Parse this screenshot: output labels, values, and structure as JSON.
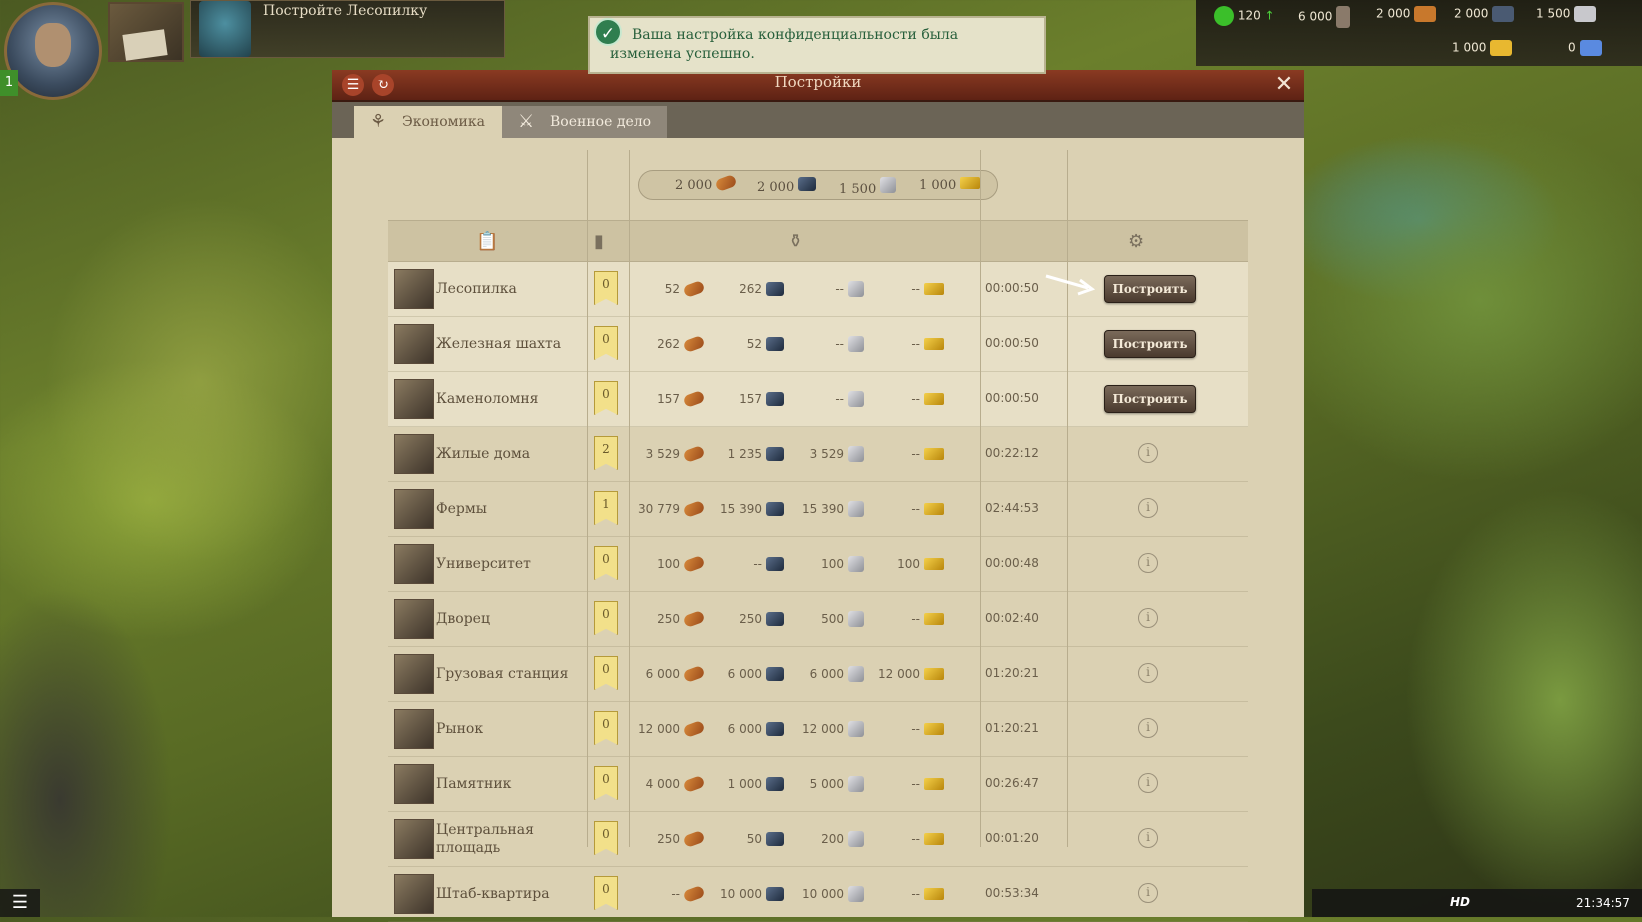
{
  "quest": {
    "text": "Постройте Лесопилку"
  },
  "player": {
    "level": "1"
  },
  "notification": {
    "text": "Ваша настройка конфиденциальности была изменена успешно."
  },
  "hud": {
    "row1": [
      {
        "value": "120",
        "icon": "happy-face-icon"
      },
      {
        "value": "6 000",
        "icon": "population-icon"
      },
      {
        "value": "2 000",
        "icon": "wood-icon"
      },
      {
        "value": "2 000",
        "icon": "iron-icon"
      },
      {
        "value": "1 500",
        "icon": "stone-icon"
      }
    ],
    "row2": [
      {
        "value": "1 000",
        "icon": "gold-icon"
      },
      {
        "value": "0",
        "icon": "gem-icon"
      }
    ],
    "time": "21:34:57",
    "hd": "HD"
  },
  "dialog": {
    "title": "Постройки",
    "tabs": [
      {
        "label": "Экономика",
        "active": true
      },
      {
        "label": "Военное дело",
        "active": false
      }
    ],
    "stock": {
      "wood": "2 000",
      "iron": "2 000",
      "stone": "1 500",
      "gold": "1 000"
    },
    "build_label": "Построить",
    "rows": [
      {
        "name": "Лесопилка",
        "level": "0",
        "wood": "52",
        "iron": "262",
        "stone": "--",
        "gold": "--",
        "time": "00:00:50",
        "action": "build"
      },
      {
        "name": "Железная шахта",
        "level": "0",
        "wood": "262",
        "iron": "52",
        "stone": "--",
        "gold": "--",
        "time": "00:00:50",
        "action": "build"
      },
      {
        "name": "Каменоломня",
        "level": "0",
        "wood": "157",
        "iron": "157",
        "stone": "--",
        "gold": "--",
        "time": "00:00:50",
        "action": "build"
      },
      {
        "name": "Жилые дома",
        "level": "2",
        "wood": "3 529",
        "iron": "1 235",
        "stone": "3 529",
        "gold": "--",
        "time": "00:22:12",
        "action": "info"
      },
      {
        "name": "Фермы",
        "level": "1",
        "wood": "30 779",
        "iron": "15 390",
        "stone": "15 390",
        "gold": "--",
        "time": "02:44:53",
        "action": "info"
      },
      {
        "name": "Университет",
        "level": "0",
        "wood": "100",
        "iron": "--",
        "stone": "100",
        "gold": "100",
        "time": "00:00:48",
        "action": "info"
      },
      {
        "name": "Дворец",
        "level": "0",
        "wood": "250",
        "iron": "250",
        "stone": "500",
        "gold": "--",
        "time": "00:02:40",
        "action": "info"
      },
      {
        "name": "Грузовая станция",
        "level": "0",
        "wood": "6 000",
        "iron": "6 000",
        "stone": "6 000",
        "gold": "12 000",
        "time": "01:20:21",
        "action": "info"
      },
      {
        "name": "Рынок",
        "level": "0",
        "wood": "12 000",
        "iron": "6 000",
        "stone": "12 000",
        "gold": "--",
        "time": "01:20:21",
        "action": "info"
      },
      {
        "name": "Памятник",
        "level": "0",
        "wood": "4 000",
        "iron": "1 000",
        "stone": "5 000",
        "gold": "--",
        "time": "00:26:47",
        "action": "info"
      },
      {
        "name": "Центральная площадь",
        "level": "0",
        "wood": "250",
        "iron": "50",
        "stone": "200",
        "gold": "--",
        "time": "00:01:20",
        "action": "info"
      },
      {
        "name": "Штаб-квартира",
        "level": "0",
        "wood": "--",
        "iron": "10 000",
        "stone": "10 000",
        "gold": "--",
        "time": "00:53:34",
        "action": "info"
      }
    ]
  }
}
